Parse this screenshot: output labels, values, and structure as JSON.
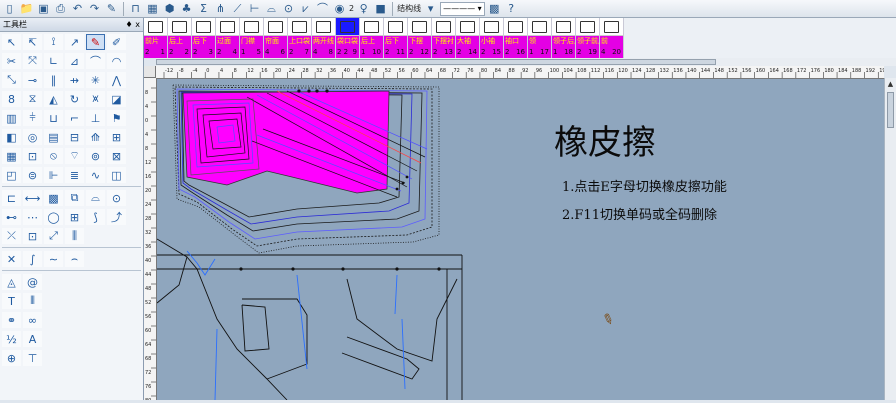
{
  "toolbar": {
    "color_index": "2",
    "line_type_label": "结构线",
    "icons": [
      "new-icon",
      "open-icon",
      "save-icon",
      "undo-icon",
      "redo-icon",
      "pen-icon",
      "tab-icon",
      "grid-icon",
      "pattern-icon",
      "color-wheel-icon",
      "lamp-icon",
      "color-swatch-icon"
    ]
  },
  "left_panel": {
    "title": "工具栏",
    "pin_label": "♦ x"
  },
  "tabs": [
    {
      "name": "前片",
      "num": "1",
      "sub": "2"
    },
    {
      "name": "后上",
      "num": "2",
      "sub": "2"
    },
    {
      "name": "后下",
      "num": "3",
      "sub": "2"
    },
    {
      "name": "过面",
      "num": "4",
      "sub": "2"
    },
    {
      "name": "门襟",
      "num": "5",
      "sub": "1"
    },
    {
      "name": "帘面",
      "num": "6",
      "sub": "4"
    },
    {
      "name": "上口袋",
      "num": "7",
      "sub": "2"
    },
    {
      "name": "两开线",
      "num": "8",
      "sub": "4"
    },
    {
      "name": "袋口袋",
      "num": "9",
      "sub": "2 2"
    },
    {
      "name": "后上",
      "num": "10",
      "sub": "1"
    },
    {
      "name": "后下",
      "num": "11",
      "sub": "2"
    },
    {
      "name": "下摆",
      "num": "12",
      "sub": "2"
    },
    {
      "name": "下摆衬",
      "num": "13",
      "sub": "2"
    },
    {
      "name": "大袖",
      "num": "14",
      "sub": "2"
    },
    {
      "name": "小袖",
      "num": "15",
      "sub": "2"
    },
    {
      "name": "袖口",
      "num": "16",
      "sub": "2"
    },
    {
      "name": "领",
      "num": "17",
      "sub": "1"
    },
    {
      "name": "领子后片",
      "num": "18",
      "sub": "1"
    },
    {
      "name": "领子前片",
      "num": "19",
      "sub": "2"
    },
    {
      "name": "前",
      "num": "20",
      "sub": "4"
    }
  ],
  "ruler_h": [
    "-12",
    "-8",
    "-4",
    "0",
    "4",
    "8",
    "12",
    "16",
    "20",
    "24",
    "28",
    "32",
    "36",
    "40",
    "44",
    "48",
    "52",
    "56",
    "60",
    "64",
    "68",
    "72",
    "76",
    "80",
    "84",
    "88",
    "92",
    "96",
    "100",
    "104",
    "108",
    "112",
    "116",
    "120",
    "124",
    "128",
    "132",
    "136",
    "140",
    "144",
    "148",
    "152",
    "156",
    "160",
    "164",
    "168",
    "172",
    "176",
    "180",
    "184",
    "188",
    "192",
    "196"
  ],
  "ruler_v": [
    "8",
    "4",
    "0",
    "4",
    "8",
    "12",
    "16",
    "20",
    "24",
    "28",
    "32",
    "36",
    "40",
    "44",
    "48",
    "52",
    "56",
    "60",
    "64",
    "68",
    "72",
    "76",
    "80"
  ],
  "caption": {
    "title": "橡皮擦",
    "line1": "1.点击E字母切换橡皮擦功能",
    "line2": "2.F11切换单码或全码删除"
  },
  "colors": {
    "pattern_fill": "#ff00ff",
    "canvas_bg": "#8fa6be",
    "tab_bg": "#e400e4",
    "tab_text": "#ffef00"
  }
}
